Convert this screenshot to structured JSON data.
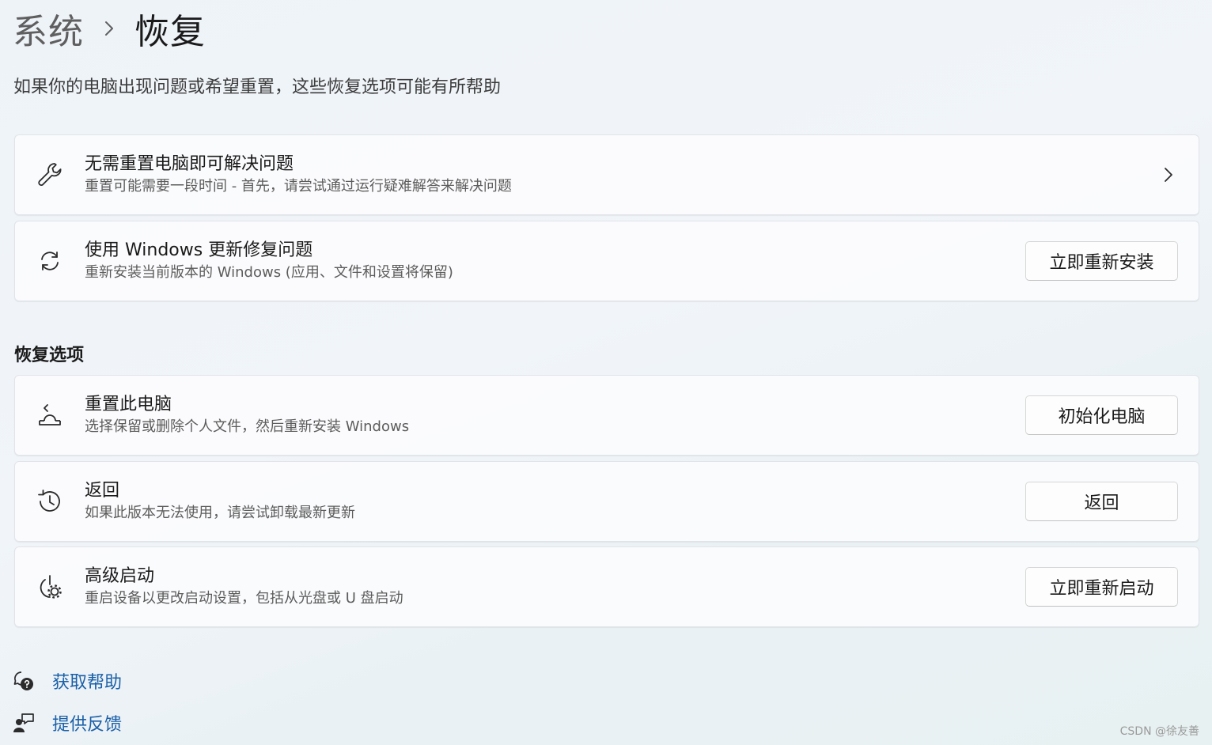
{
  "breadcrumb": {
    "parent": "系统",
    "current": "恢复"
  },
  "subtitle": "如果你的电脑出现问题或希望重置，这些恢复选项可能有所帮助",
  "top_cards": [
    {
      "title": "无需重置电脑即可解决问题",
      "description": "重置可能需要一段时间 - 首先，请尝试通过运行疑难解答来解决问题",
      "icon": "wrench-icon"
    },
    {
      "title": "使用 Windows 更新修复问题",
      "description": "重新安装当前版本的 Windows (应用、文件和设置将保留)",
      "button": "立即重新安装",
      "icon": "sync-icon"
    }
  ],
  "recovery_section": {
    "title": "恢复选项",
    "items": [
      {
        "title": "重置此电脑",
        "description": "选择保留或删除个人文件，然后重新安装 Windows",
        "button": "初始化电脑",
        "icon": "reset-pc-icon"
      },
      {
        "title": "返回",
        "description": "如果此版本无法使用，请尝试卸载最新更新",
        "button": "返回",
        "icon": "history-icon"
      },
      {
        "title": "高级启动",
        "description": "重启设备以更改启动设置，包括从光盘或 U 盘启动",
        "button": "立即重新启动",
        "icon": "advanced-startup-icon"
      }
    ]
  },
  "links": {
    "get_help": "获取帮助",
    "feedback": "提供反馈"
  },
  "watermark": "CSDN @徐友善",
  "colors": {
    "link": "#1a5fa8",
    "card_background": "#fcfdfe",
    "page_background": "#eef3f8"
  }
}
